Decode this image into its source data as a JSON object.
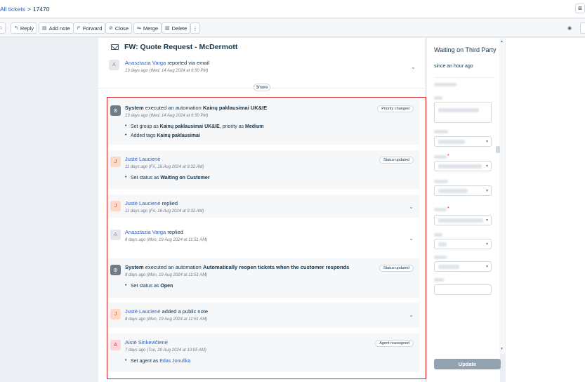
{
  "breadcrumb": {
    "all_tickets": "All tickets",
    "separator": ">",
    "ticket_id": "17470"
  },
  "top_right_icon": "⊞",
  "toolbar": {
    "star_icon": "☆",
    "reply": "Reply",
    "add_note": "Add note",
    "forward": "Forward",
    "close": "Close",
    "merge": "Merge",
    "delete": "Delete",
    "more": "⋮",
    "eye_icon": "◉",
    "reply_icon": "↰",
    "note_icon": "▤",
    "forward_icon": "↱",
    "close_icon": "⊘",
    "merge_icon": "⇋",
    "delete_icon": "▥"
  },
  "ticket": {
    "subject": "FW: Quote Request - McDermott",
    "reporter": {
      "avatar": "A",
      "name": "Anasztazia Varga",
      "action": "reported via email",
      "time": "13 days ago (Wed, 14 Aug 2024 at 6:50 PM)"
    },
    "more_label": "3more"
  },
  "activities": [
    {
      "avatar": "⚙",
      "actor": "System",
      "text_a": "executed an automation",
      "automation": "Kainų paklausimai UK&IE",
      "time": "13 days ago (Wed, 14 Aug 2024 at 6:50 PM)",
      "badge": "Priority changed",
      "item1_a": "Set group as",
      "item1_b": "Kainų paklausimai UK&IE",
      "item1_c": ", priority as",
      "item1_d": "Medium",
      "item2_a": "Added tags",
      "item2_b": "Kainų paklausimai"
    },
    {
      "avatar": "J",
      "actor": "Justė Laucienė",
      "time": "11 days ago (Fri, 16 Aug 2024 at 9:32 AM)",
      "badge": "Status updated",
      "item1_a": "Set status as",
      "item1_b": "Waiting on Customer"
    },
    {
      "avatar": "J",
      "actor": "Justė Laucienė",
      "action": "replied",
      "time": "11 days ago (Fri, 16 Aug 2024 at 9:32 AM)"
    },
    {
      "avatar": "A",
      "actor": "Anasztazia Varga",
      "action": "replied",
      "time": "8 days ago (Mon, 19 Aug 2024 at 11:51 AM)"
    },
    {
      "avatar": "⚙",
      "actor": "System",
      "text_a": "executed an automation",
      "automation": "Automatically reopen tickets when the customer responds",
      "time": "8 days ago (Mon, 19 Aug 2024 at 11:51 AM)",
      "badge": "Status updated",
      "item1_a": "Set status as",
      "item1_b": "Open"
    },
    {
      "avatar": "J",
      "actor": "Justė Laucienė",
      "action": "added a public note",
      "time": "8 days ago (Mon, 19 Aug 2024 at 11:51 AM)"
    },
    {
      "avatar": "A",
      "actor": "Aistė Sinkevičienė",
      "time": "7 days ago (Tue, 20 Aug 2024 at 10:05 AM)",
      "badge": "Agent reassigned",
      "item1_a": "Set agent as",
      "item1_b": "Edas Jonuška"
    }
  ],
  "chevron": "⌄",
  "panel": {
    "status": "Waiting on Third Party",
    "since": "since an hour ago",
    "update": "Update",
    "required_mark": "*",
    "dropdown_icon": "▾"
  },
  "colors": {
    "accent": "#2c5cc5",
    "highlight": "#e02020",
    "update_btn": "#92a2b1"
  }
}
